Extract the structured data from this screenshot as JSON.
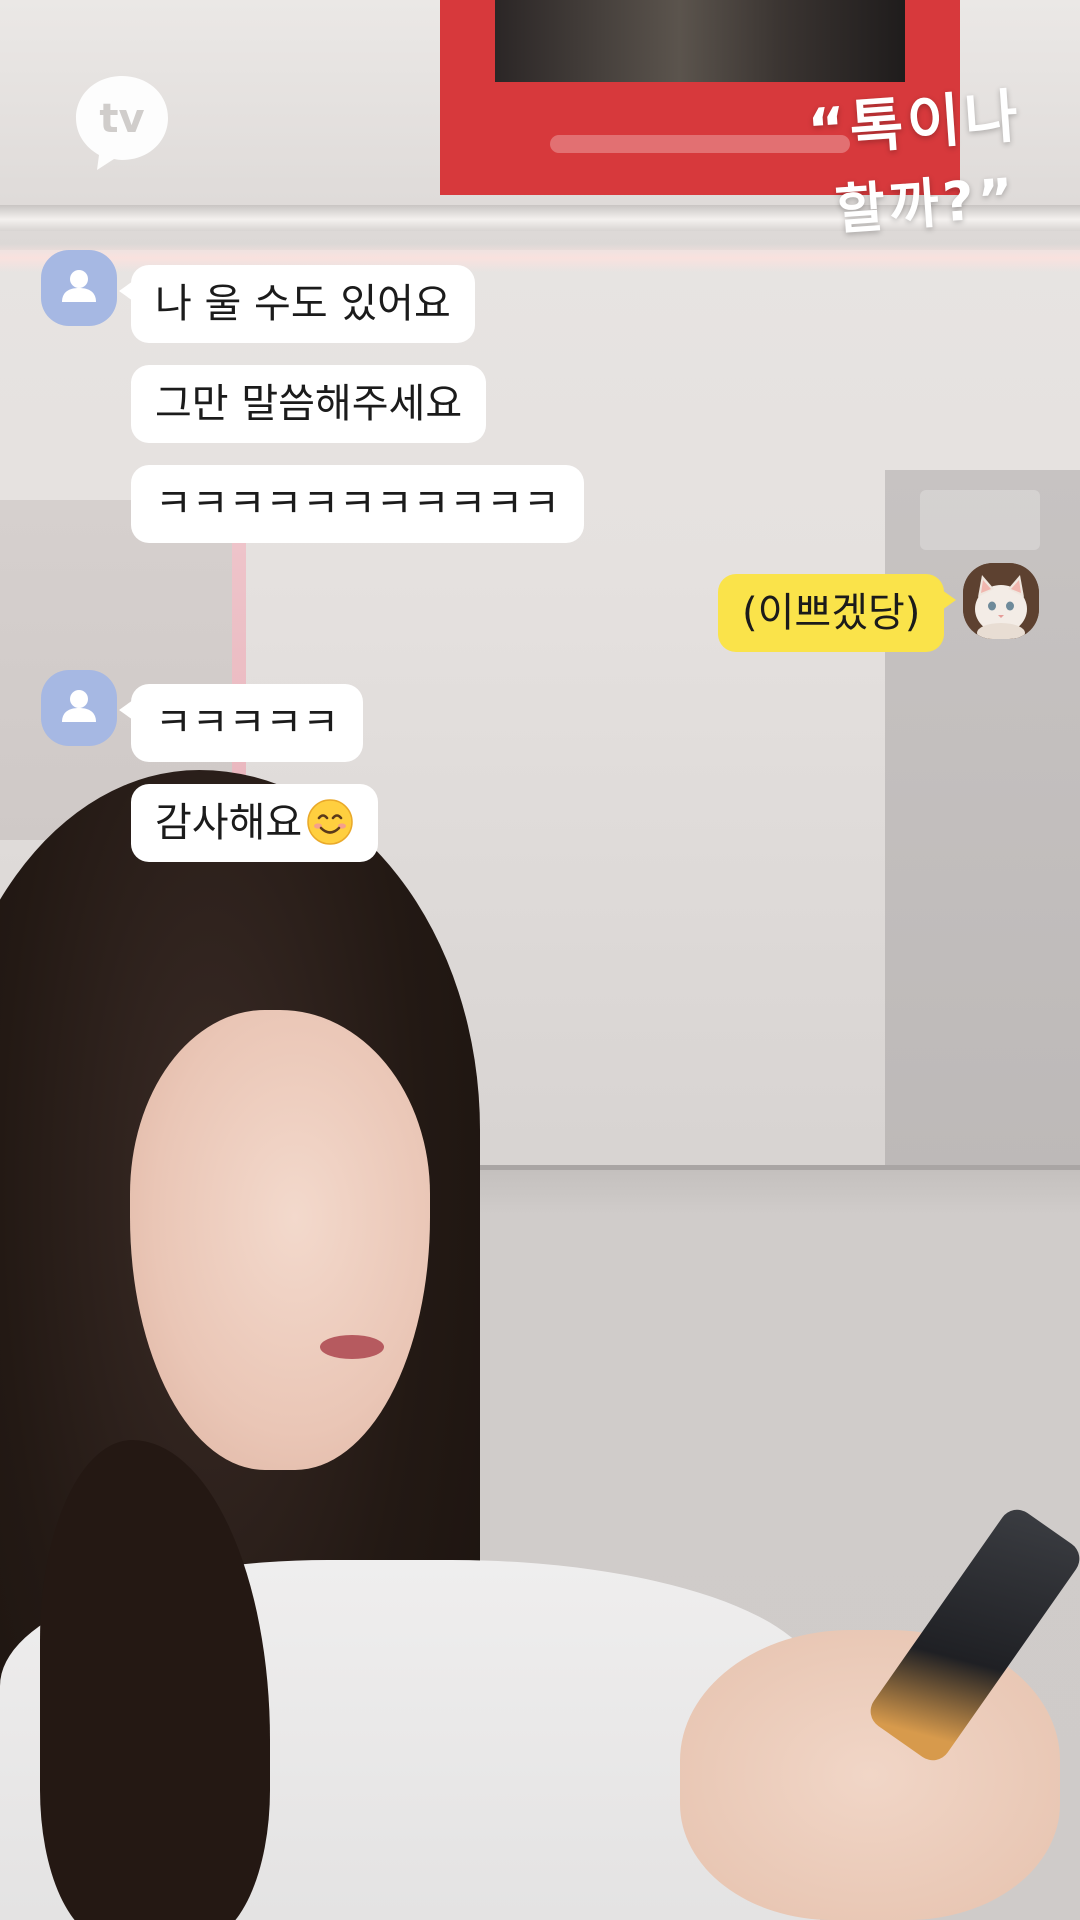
{
  "channel_logo": "tv",
  "show_title": {
    "line1": "“톡이나",
    "line2": "할까?”"
  },
  "chat": {
    "group1": {
      "sender_avatar_icon": "person-icon",
      "messages": [
        "나 울 수도 있어요",
        "그만 말씀해주세요",
        "ㅋㅋㅋㅋㅋㅋㅋㅋㅋㅋㅋ"
      ]
    },
    "my_message": {
      "text": "(이쁘겠당)",
      "avatar": "cat-photo"
    },
    "group2": {
      "sender_avatar_icon": "person-icon",
      "messages": [
        "ㅋㅋㅋㅋㅋ",
        "감사해요"
      ],
      "emoji": "smiling-face-emoji"
    }
  },
  "colors": {
    "incoming_bubble": "#ffffff",
    "outgoing_bubble": "#fae34a",
    "avatar_placeholder": "#a6b8e3"
  }
}
